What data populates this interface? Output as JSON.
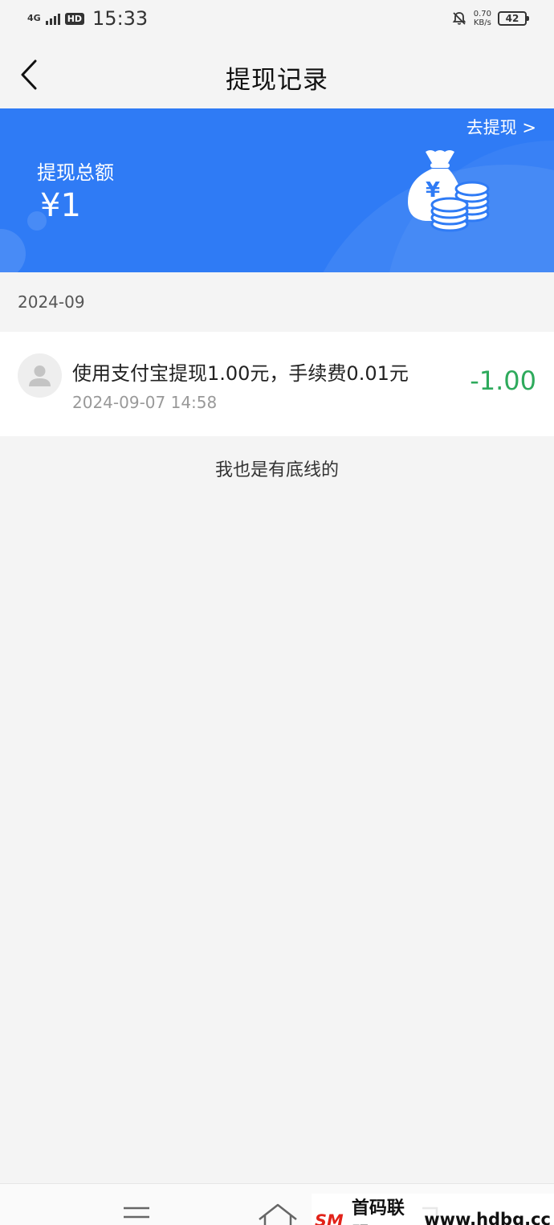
{
  "status_bar": {
    "network": "4G",
    "hd": "HD",
    "time": "15:33",
    "speed_value": "0.70",
    "speed_unit": "KB/s",
    "battery": "42"
  },
  "nav": {
    "title": "提现记录",
    "back_icon": "chevron-left-icon"
  },
  "banner": {
    "withdraw_link": "去提现 >",
    "total_label": "提现总额",
    "total_amount": "¥1",
    "bg_color": "#2f7bf5",
    "illustration_icon": "money-bag-icon"
  },
  "records": {
    "month": "2024-09",
    "items": [
      {
        "description": "使用支付宝提现1.00元，手续费0.01元",
        "time": "2024-09-07 14:58",
        "amount": "-1.00",
        "amount_color": "#2eaa5c"
      }
    ],
    "end_text": "我也是有底线的"
  },
  "watermark": {
    "logo_text": "SM",
    "text": "首码联盟",
    "url": "www.hdbq.cc"
  }
}
